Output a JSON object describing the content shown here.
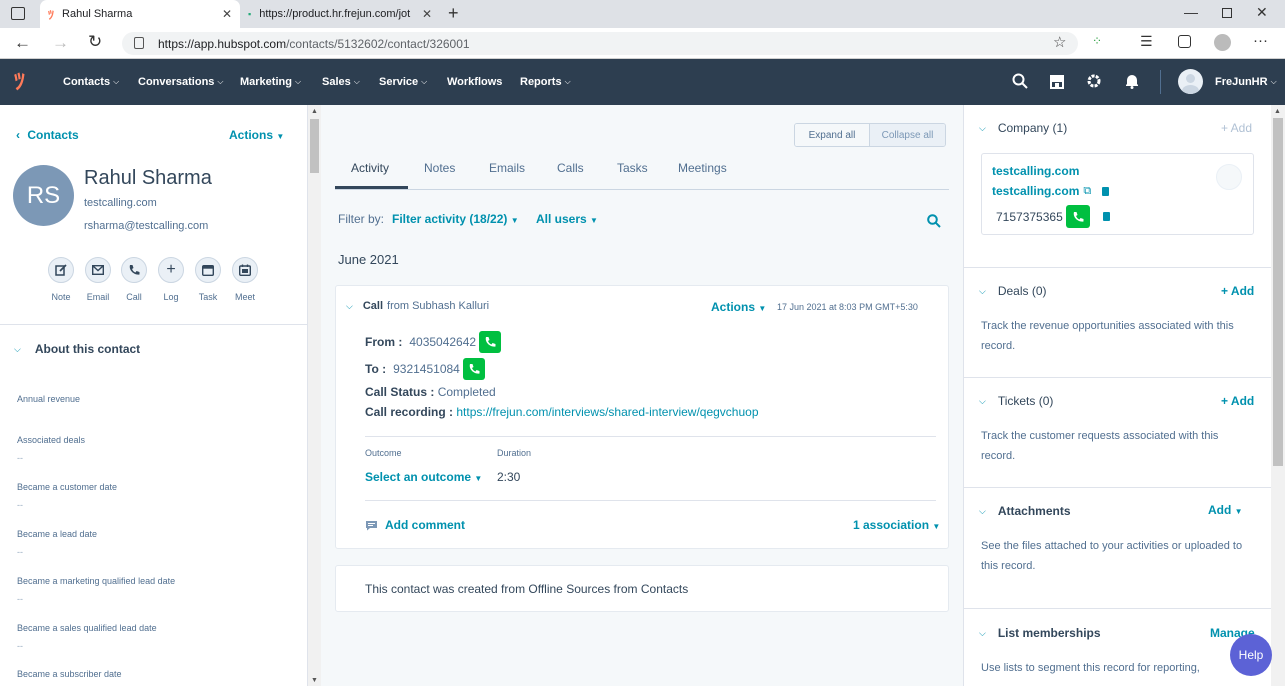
{
  "browser": {
    "tabs": [
      {
        "title": "Rahul Sharma"
      },
      {
        "title": "https://product.hr.frejun.com/jot"
      }
    ],
    "url_host": "https://app.hubspot.com",
    "url_path": "/contacts/5132602/contact/326001"
  },
  "nav": {
    "items": [
      "Contacts",
      "Conversations",
      "Marketing",
      "Sales",
      "Service",
      "Workflows",
      "Reports"
    ],
    "user": "FreJunHR"
  },
  "contact": {
    "back": "Contacts",
    "actions": "Actions",
    "initials": "RS",
    "name": "Rahul Sharma",
    "company": "testcalling.com",
    "email": "rsharma@testcalling.com",
    "quick_actions": [
      "Note",
      "Email",
      "Call",
      "Log",
      "Task",
      "Meet"
    ]
  },
  "about": {
    "title": "About this contact",
    "props": [
      {
        "label": "Annual revenue",
        "value": ""
      },
      {
        "label": "Associated deals",
        "value": "--"
      },
      {
        "label": "Became a customer date",
        "value": "--"
      },
      {
        "label": "Became a lead date",
        "value": "--"
      },
      {
        "label": "Became a marketing qualified lead date",
        "value": "--"
      },
      {
        "label": "Became a sales qualified lead date",
        "value": "--"
      },
      {
        "label": "Became a subscriber date",
        "value": ""
      }
    ]
  },
  "activity": {
    "expand_all": "Expand all",
    "collapse_all": "Collapse all",
    "tabs": [
      "Activity",
      "Notes",
      "Emails",
      "Calls",
      "Tasks",
      "Meetings"
    ],
    "filter_by": "Filter by:",
    "filter_activity": "Filter activity (18/22)",
    "all_users": "All users",
    "month": "June 2021",
    "call": {
      "type": "Call",
      "from_text": "from Subhash Kalluri",
      "actions": "Actions",
      "timestamp": "17 Jun 2021 at 8:03 PM GMT+5:30",
      "from_label": "From :",
      "from_number": "4035042642",
      "to_label": "To :",
      "to_number": "9321451084",
      "status_label": "Call Status :",
      "status_value": "Completed",
      "recording_label": "Call recording :",
      "recording_url": "https://frejun.com/interviews/shared-interview/qegvchuop",
      "outcome_label": "Outcome",
      "outcome_value": "Select an outcome",
      "duration_label": "Duration",
      "duration_value": "2:30",
      "add_comment": "Add comment",
      "association": "1 association"
    },
    "created_note": "This contact was created from Offline Sources from Contacts"
  },
  "sidebar": {
    "company": {
      "title": "Company (1)",
      "add": "+ Add",
      "name": "testcalling.com",
      "domain": "testcalling.com",
      "phone": "7157375365"
    },
    "deals": {
      "title": "Deals (0)",
      "add": "+ Add",
      "desc": "Track the revenue opportunities associated with this record."
    },
    "tickets": {
      "title": "Tickets (0)",
      "add": "+ Add",
      "desc": "Track the customer requests associated with this record."
    },
    "attachments": {
      "title": "Attachments",
      "add": "Add",
      "desc": "See the files attached to your activities or uploaded to this record."
    },
    "lists": {
      "title": "List memberships",
      "manage": "Manage",
      "desc": "Use lists to segment this record for reporting,"
    }
  },
  "help": "Help",
  "colors": {
    "nav": "#2d3e50",
    "link": "#0091ae",
    "green": "#00bf40",
    "avatar": "#7c98b6",
    "help": "#5c62d6"
  }
}
